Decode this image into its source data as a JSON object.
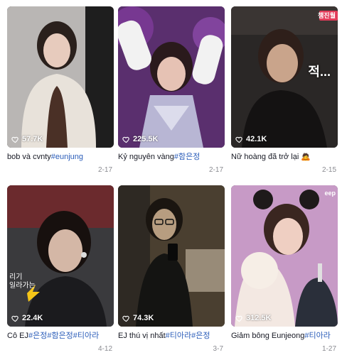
{
  "videos": [
    {
      "views": "57.7K",
      "caption_text": "bob và cvnty",
      "caption_tags": "#eunjung",
      "date": "2-17",
      "colors": {
        "bg": "#b9b6b4",
        "accent": "#e8e2da"
      }
    },
    {
      "views": "225.5K",
      "caption_text": "Kỷ nguyên vàng",
      "caption_tags": "#함은정",
      "date": "2-17",
      "colors": {
        "bg": "#5a2f6e",
        "accent": "#f2f2f2"
      }
    },
    {
      "views": "42.1K",
      "caption_text": "Nữ hoàng đã trở lại 🙇",
      "caption_tags": "",
      "date": "2-15",
      "overlay": "적...",
      "corner_badge": "챔진월",
      "colors": {
        "bg": "#2a2726",
        "accent": "#c9a48b"
      }
    },
    {
      "views": "22.4K",
      "caption_text": "Cô EJ",
      "caption_tags": "#은정#함은정#티아라",
      "date": "4-12",
      "overlay_side": "리기\n일라가는",
      "colors": {
        "bg": "#3a3a3d",
        "accent": "#d4b7a6"
      }
    },
    {
      "views": "74.3K",
      "caption_text": "EJ thú vị nhất",
      "caption_tags": "#티아라#은정",
      "date": "3-7",
      "colors": {
        "bg": "#4a3f30",
        "accent": "#b79d80"
      }
    },
    {
      "views": "312.5K",
      "caption_text": "Giảm bông Eunjeong",
      "caption_tags": "#티아라",
      "date": "1-27",
      "corner_badge": "eep",
      "colors": {
        "bg": "#c79ac6",
        "accent": "#f3e8e2"
      }
    }
  ]
}
